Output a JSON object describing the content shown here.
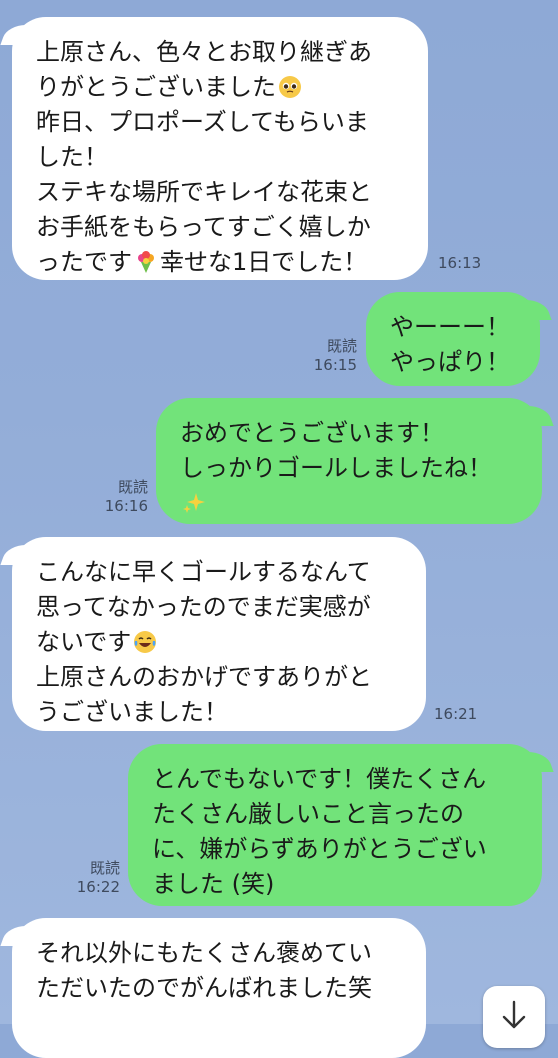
{
  "messages": [
    {
      "id": "m1",
      "direction": "incoming",
      "lines": [
        "上原さん、色々とお取り継ぎあ",
        "りがとうございました",
        "昨日、プロポーズしてもらいま",
        "した！",
        "ステキな場所でキレイな花束と",
        "お手紙をもらってすごく嬉しか",
        "ったです",
        "幸せな1日でした！"
      ],
      "emojis": [
        "pleading-face-emoji",
        "bouquet-emoji"
      ],
      "time": "16:13"
    },
    {
      "id": "m2",
      "direction": "outgoing",
      "lines": [
        "やーーー！",
        "やっぱり！"
      ],
      "read_label": "既読",
      "time": "16:15"
    },
    {
      "id": "m3",
      "direction": "outgoing",
      "lines": [
        "おめでとうございます！",
        "しっかりゴールしましたね！"
      ],
      "emojis": [
        "sparkles-emoji"
      ],
      "read_label": "既読",
      "time": "16:16"
    },
    {
      "id": "m4",
      "direction": "incoming",
      "lines": [
        "こんなに早くゴールするなんて",
        "思ってなかったのでまだ実感が",
        "ないです",
        "上原さんのおかげですありがと",
        "うございました！"
      ],
      "emojis": [
        "tears-of-joy-emoji"
      ],
      "time": "16:21"
    },
    {
      "id": "m5",
      "direction": "outgoing",
      "lines": [
        "とんでもないです！僕たくさん",
        "たくさん厳しいこと言ったの",
        "に、嫌がらずありがとうござい",
        "ました (笑)"
      ],
      "read_label": "既読",
      "time": "16:22"
    },
    {
      "id": "m6",
      "direction": "incoming",
      "lines": [
        "それ以外にもたくさん褒めてい",
        "ただいたのでがんばれました笑"
      ]
    }
  ],
  "colors": {
    "background": "#93add8",
    "incoming_bubble": "#ffffff",
    "outgoing_bubble": "#72e37a",
    "meta_text": "#3e4a5e"
  },
  "scroll_button": {
    "icon": "arrow-down-icon"
  }
}
